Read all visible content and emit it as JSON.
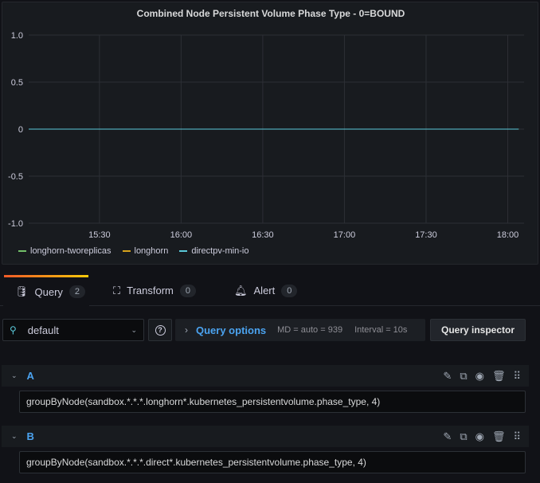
{
  "panel": {
    "title": "Combined Node Persistent Volume Phase Type - 0=BOUND"
  },
  "chart_data": {
    "type": "line",
    "title": "Combined Node Persistent Volume Phase Type - 0=BOUND",
    "ylim": [
      -1,
      1
    ],
    "y_ticks": [
      "1.0",
      "0.5",
      "0",
      "-0.5",
      "-1.0"
    ],
    "x_ticks": [
      "15:30",
      "16:00",
      "16:30",
      "17:00",
      "17:30",
      "18:00"
    ],
    "xlim": [
      "15:04",
      "18:06"
    ],
    "grid": true,
    "legend_placement": "bottom-left",
    "series": [
      {
        "name": "longhorn-tworeplicas",
        "color": "#73bf69",
        "x": [
          "15:04",
          "18:04"
        ],
        "values": [
          0,
          0
        ]
      },
      {
        "name": "longhorn",
        "color": "#d6a21c",
        "x": [
          "15:04",
          "18:04"
        ],
        "values": [
          0,
          0
        ]
      },
      {
        "name": "directpv-min-io",
        "color": "#5ac8d8",
        "x": [
          "15:04",
          "18:04"
        ],
        "values": [
          0,
          0
        ]
      }
    ]
  },
  "tabs": [
    {
      "label": "Query",
      "count": "2",
      "icon": "database-icon"
    },
    {
      "label": "Transform",
      "count": "0",
      "icon": "transform-icon"
    },
    {
      "label": "Alert",
      "count": "0",
      "icon": "bell-icon"
    }
  ],
  "datasource": {
    "value": "default"
  },
  "query_options": {
    "label": "Query options",
    "md": "MD = auto = 939",
    "interval": "Interval = 10s"
  },
  "query_inspector": "Query inspector",
  "queries": [
    {
      "ref": "A",
      "expr": "groupByNode(sandbox.*.*.*.longhorn*.kubernetes_persistentvolume.phase_type, 4)"
    },
    {
      "ref": "B",
      "expr": "groupByNode(sandbox.*.*.*.direct*.kubernetes_persistentvolume.phase_type, 4)"
    }
  ]
}
